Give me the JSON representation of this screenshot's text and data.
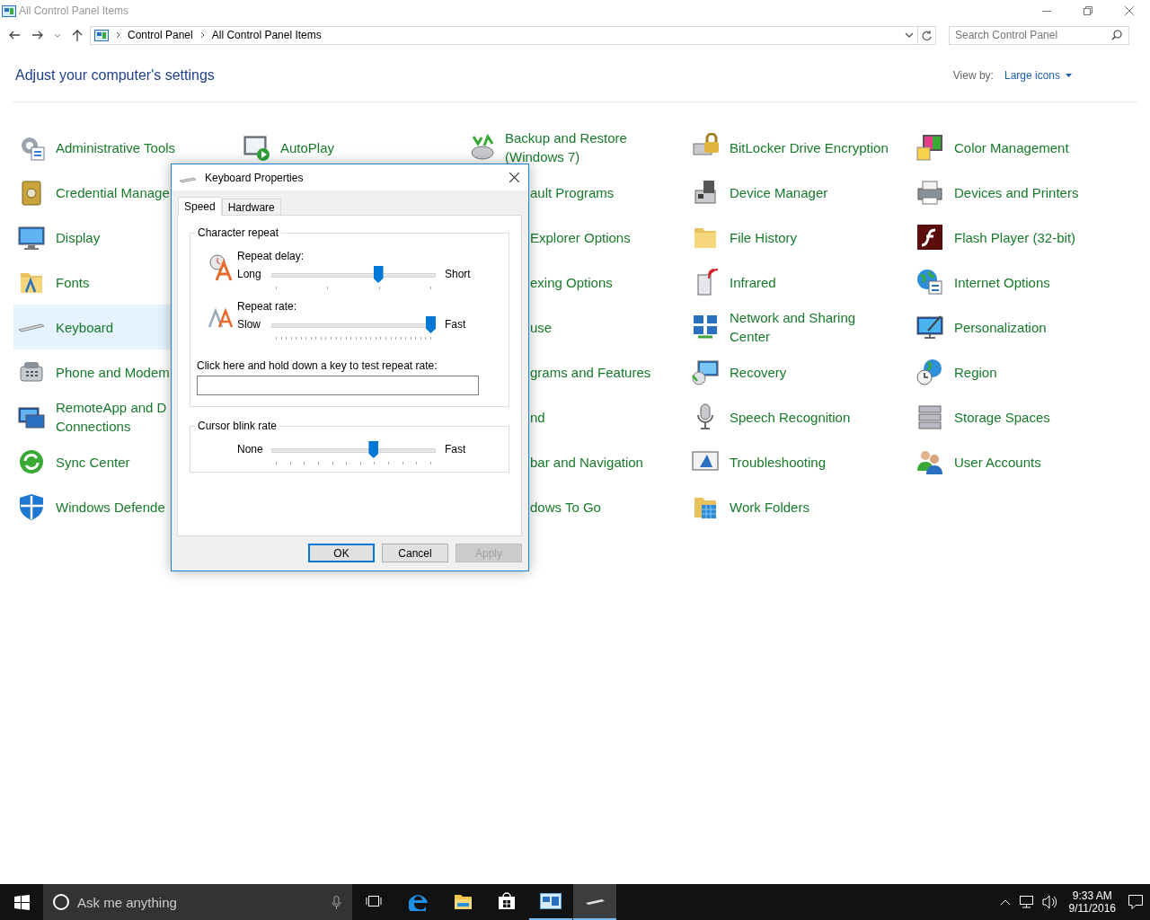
{
  "window": {
    "title": "All Control Panel Items"
  },
  "address_bar": {
    "breadcrumbs": [
      "Control Panel",
      "All Control Panel Items"
    ]
  },
  "search": {
    "placeholder": "Search Control Panel"
  },
  "heading": "Adjust your computer's settings",
  "view_by": {
    "label": "View by:",
    "value": "Large icons"
  },
  "columns": [
    [
      {
        "label": "Administrative Tools",
        "kind": "full",
        "selected": false
      },
      {
        "label": "Credential Manage",
        "kind": "full",
        "selected": false
      },
      {
        "label": "Display",
        "kind": "full",
        "selected": false
      },
      {
        "label": "Fonts",
        "kind": "full",
        "selected": false
      },
      {
        "label": "Keyboard",
        "kind": "full",
        "selected": true
      },
      {
        "label": "Phone and Modem",
        "kind": "full",
        "selected": false
      },
      {
        "label": "RemoteApp and D\nConnections",
        "kind": "full",
        "selected": false
      },
      {
        "label": "Sync Center",
        "kind": "full",
        "selected": false
      },
      {
        "label": "Windows Defende",
        "kind": "full",
        "selected": false
      }
    ],
    [
      {
        "label": "AutoPlay",
        "kind": "full",
        "selected": false
      }
    ],
    [
      {
        "label": "Backup and Restore\n(Windows 7)",
        "kind": "full",
        "selected": false
      },
      {
        "label": "ault Programs",
        "kind": "partial",
        "selected": false
      },
      {
        "label": "Explorer Options",
        "kind": "partial",
        "selected": false
      },
      {
        "label": "exing Options",
        "kind": "partial",
        "selected": false
      },
      {
        "label": "use",
        "kind": "partial",
        "selected": false
      },
      {
        "label": "grams and Features",
        "kind": "partial",
        "selected": false
      },
      {
        "label": "nd",
        "kind": "partial",
        "selected": false
      },
      {
        "label": "bar and Navigation",
        "kind": "partial",
        "selected": false
      },
      {
        "label": "dows To Go",
        "kind": "partial",
        "selected": false
      }
    ],
    [
      {
        "label": "BitLocker Drive Encryption",
        "kind": "full",
        "selected": false
      },
      {
        "label": "Device Manager",
        "kind": "full",
        "selected": false
      },
      {
        "label": "File History",
        "kind": "full",
        "selected": false
      },
      {
        "label": "Infrared",
        "kind": "full",
        "selected": false
      },
      {
        "label": "Network and Sharing\nCenter",
        "kind": "full",
        "selected": false
      },
      {
        "label": "Recovery",
        "kind": "full",
        "selected": false
      },
      {
        "label": "Speech Recognition",
        "kind": "full",
        "selected": false
      },
      {
        "label": "Troubleshooting",
        "kind": "full",
        "selected": false
      },
      {
        "label": "Work Folders",
        "kind": "full",
        "selected": false
      }
    ],
    [
      {
        "label": "Color Management",
        "kind": "full",
        "selected": false
      },
      {
        "label": "Devices and Printers",
        "kind": "full",
        "selected": false
      },
      {
        "label": "Flash Player (32-bit)",
        "kind": "full",
        "selected": false
      },
      {
        "label": "Internet Options",
        "kind": "full",
        "selected": false
      },
      {
        "label": "Personalization",
        "kind": "full",
        "selected": false
      },
      {
        "label": "Region",
        "kind": "full",
        "selected": false
      },
      {
        "label": "Storage Spaces",
        "kind": "full",
        "selected": false
      },
      {
        "label": "User Accounts",
        "kind": "full",
        "selected": false
      }
    ]
  ],
  "dialog": {
    "title": "Keyboard Properties",
    "tabs": [
      {
        "label": "Speed",
        "selected": true
      },
      {
        "label": "Hardware",
        "selected": false
      }
    ],
    "groups": [
      {
        "title": "Character repeat",
        "sliders": [
          {
            "label": "Repeat delay:",
            "min_label": "Long",
            "max_label": "Short",
            "level": 0.66
          },
          {
            "label": "Repeat rate:",
            "min_label": "Slow",
            "max_label": "Fast",
            "level": 1.0
          }
        ],
        "test_field": {
          "label": "Click here and hold down a key to test repeat rate:"
        }
      },
      {
        "title": "Cursor blink rate",
        "sliders": [
          {
            "min_label": "None",
            "max_label": "Fast",
            "level": 0.63
          }
        ]
      }
    ],
    "buttons": [
      {
        "label": "OK",
        "default": true,
        "disabled": false
      },
      {
        "label": "Cancel",
        "default": false,
        "disabled": false
      },
      {
        "label": "Apply",
        "default": false,
        "disabled": true
      }
    ]
  },
  "taskbar": {
    "search_placeholder": "Ask me anything",
    "apps": [
      {
        "kind": "task-view",
        "active": false,
        "focused": false
      },
      {
        "kind": "browser",
        "active": false,
        "focused": false
      },
      {
        "kind": "folder",
        "active": false,
        "focused": false
      },
      {
        "kind": "store",
        "active": false,
        "focused": false
      },
      {
        "kind": "control-panel",
        "active": true,
        "focused": false
      },
      {
        "kind": "keyboard",
        "active": true,
        "focused": true
      }
    ],
    "time": "9:33 AM",
    "date": "9/11/2016"
  }
}
